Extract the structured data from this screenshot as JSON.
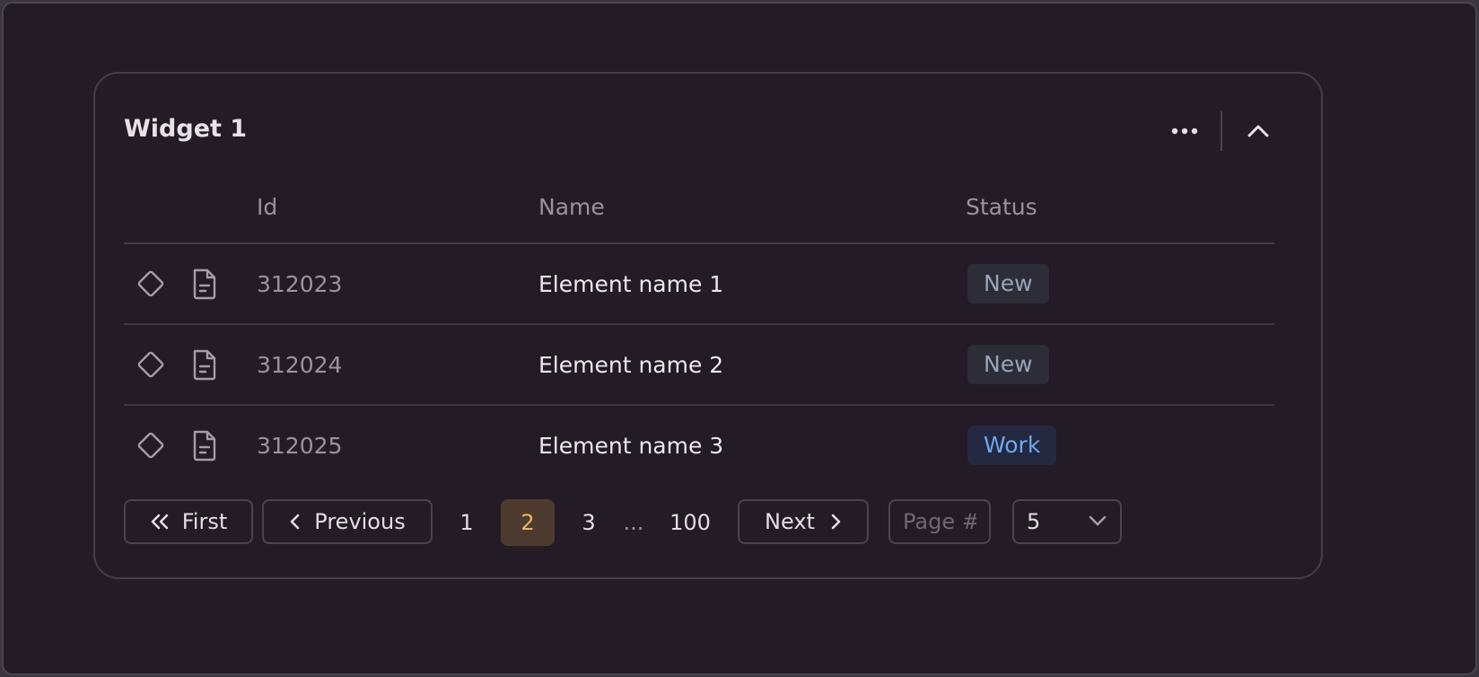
{
  "widget": {
    "title": "Widget 1"
  },
  "table": {
    "columns": [
      "Id",
      "Name",
      "Status"
    ],
    "rows": [
      {
        "id": "312023",
        "name": "Element name 1",
        "status": "New"
      },
      {
        "id": "312024",
        "name": "Element name 2",
        "status": "New"
      },
      {
        "id": "312025",
        "name": "Element name 3",
        "status": "Work"
      }
    ]
  },
  "pagination": {
    "first_label": "First",
    "previous_label": "Previous",
    "next_label": "Next",
    "pages": [
      "1",
      "2",
      "3",
      "...",
      "100"
    ],
    "current_page": "2",
    "page_input_placeholder": "Page #",
    "page_size": "5"
  },
  "colors": {
    "background": "#231b25",
    "status_new": "#98a4b8",
    "status_work": "#6fa8ee",
    "active_page": "#e9b66a"
  },
  "icons": {
    "more": "more-horizontal-icon",
    "collapse": "chevron-up-icon",
    "row_type": "diamond-icon",
    "row_doc": "document-icon"
  }
}
